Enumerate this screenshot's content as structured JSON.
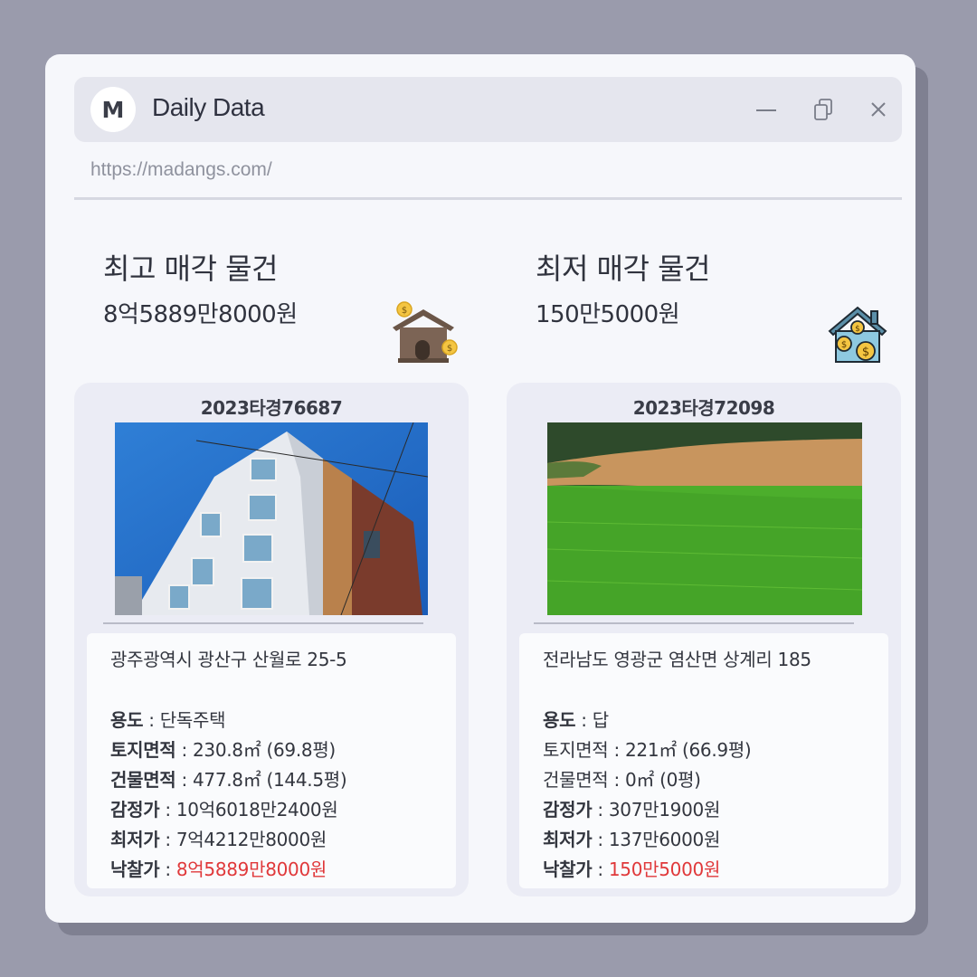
{
  "app": {
    "logo_letter": "M",
    "title": "Daily Data",
    "url": "https://madangs.com/"
  },
  "highest": {
    "heading": "최고 매각 물건",
    "price": "8억5889만8000원",
    "case_no": "2023타경76687",
    "address": "광주광역시 광산구 산월로 25-5",
    "rows": [
      {
        "key": "용도",
        "sep": " : ",
        "value": "단독주택"
      },
      {
        "key": "토지면적",
        "sep": " : ",
        "value": "230.8㎡ (69.8평)"
      },
      {
        "key": "건물면적",
        "sep": " : ",
        "value": "477.8㎡ (144.5평)"
      },
      {
        "key": "감정가",
        "sep": " : ",
        "value": "10억6018만2400원"
      },
      {
        "key": "최저가",
        "sep": " : ",
        "value": "7억4212만8000원"
      },
      {
        "key": "낙찰가",
        "sep": " : ",
        "value": "8억5889만8000원"
      }
    ]
  },
  "lowest": {
    "heading": "최저 매각 물건",
    "price": "150만5000원",
    "case_no": "2023타경72098",
    "address": "전라남도 영광군 염산면 상계리 185",
    "rows": [
      {
        "key": "용도",
        "sep": " : ",
        "value": "답"
      },
      {
        "key": "토지면적",
        "sep": " : ",
        "value": "221㎡ (66.9평)"
      },
      {
        "key": "건물면적",
        "sep": " : ",
        "value": "0㎡ (0평)"
      },
      {
        "key": "감정가",
        "sep": " : ",
        "value": "307만1900원"
      },
      {
        "key": "최저가",
        "sep": " : ",
        "value": "137만6000원"
      },
      {
        "key": "낙찰가",
        "sep": " : ",
        "value": "150만5000원"
      }
    ]
  },
  "icons": [
    "house-money-icon",
    "house-coins-icon",
    "minimize-icon",
    "restore-icon",
    "close-icon"
  ],
  "colors": {
    "accent_red": "#e0383a",
    "background": "#9a9bac",
    "window": "#f6f7fb"
  }
}
